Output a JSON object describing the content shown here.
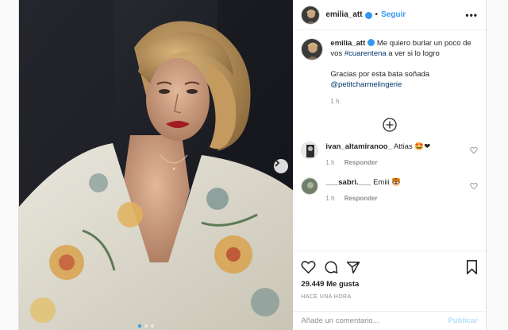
{
  "header": {
    "username": "emilia_att",
    "separator": "•",
    "follow_label": "Seguir",
    "more_label": "•••"
  },
  "caption": {
    "username": "emilia_att",
    "text_before": "Me quiero burlar un poco de vos ",
    "hashtag": "#cuarentena",
    "text_after": " a ver si lo logro",
    "line2_text": "Gracias por esta bata soñada",
    "mention": "@petitcharmelingerie",
    "time": "1 h"
  },
  "comments": [
    {
      "username": "ivan_altamiranoo_",
      "text": "Attias",
      "emoji": "🤩❤",
      "time": "1 h",
      "reply_label": "Responder"
    },
    {
      "username": "___sabri.___",
      "text": "Emiii",
      "emoji": "🐯",
      "time": "1 h",
      "reply_label": "Responder"
    }
  ],
  "footer": {
    "likes": "29.449 Me gusta",
    "timestamp": "HACE UNA HORA",
    "comment_placeholder": "Añade un comentario...",
    "publish_label": "Publicar"
  },
  "icons": {
    "like": "heart-icon",
    "comment": "comment-icon",
    "share": "share-icon",
    "save": "bookmark-icon",
    "add_more": "plus-circle-icon",
    "next": "chevron-right-icon"
  },
  "colors": {
    "accent": "#3897f0",
    "link": "#00376b",
    "muted": "#8e8e8e"
  },
  "carousel": {
    "current": 1,
    "total": 3
  }
}
